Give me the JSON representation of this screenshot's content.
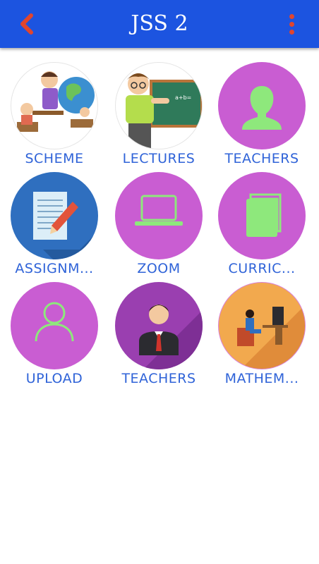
{
  "appbar": {
    "title": "JSS 2"
  },
  "tiles": [
    {
      "label": "SCHEME"
    },
    {
      "label": "LECTURES"
    },
    {
      "label": "TEACHERS"
    },
    {
      "label": "ASSIGNM..."
    },
    {
      "label": "ZOOM"
    },
    {
      "label": "CURRIC..."
    },
    {
      "label": "UPLOAD"
    },
    {
      "label": "TEACHERS"
    },
    {
      "label": "MATHEM..."
    }
  ],
  "colors": {
    "appbar": "#1c54e0",
    "accent": "#e0452e",
    "tile_purple": "#c95dd2",
    "label": "#2f63d8",
    "icon_green": "#8ee87c"
  }
}
